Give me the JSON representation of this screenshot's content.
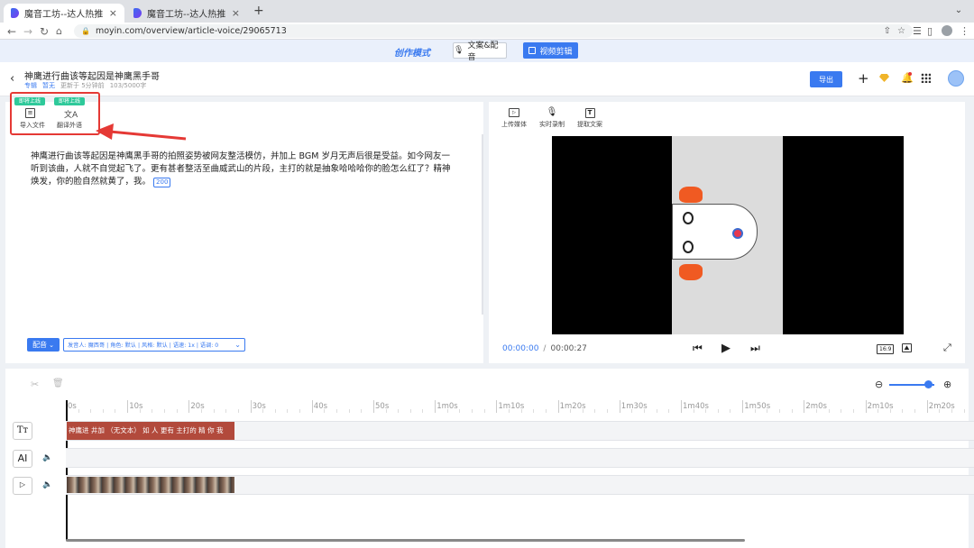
{
  "browser": {
    "tabs": [
      {
        "title": "魔音工坊--达人热推的短视频/有",
        "close": "×"
      },
      {
        "title": "魔音工坊--达人热推的短视频/有",
        "close": "×"
      }
    ],
    "new_tab": "+",
    "url": "moyin.com/overview/article-voice/29065713"
  },
  "mode_bar": {
    "logo": "创作模式",
    "text_dub_label": "文案&配音",
    "video_edit_label": "视频剪辑"
  },
  "header": {
    "title": "神鹰进行曲该等起因是神鹰黑手哥",
    "meta_items": [
      "专辑",
      "暂无",
      "更新于 5分钟前",
      "103/5000字"
    ],
    "export_label": "导出"
  },
  "editor": {
    "tools": [
      {
        "badge": "即将上线",
        "label": "导入文件",
        "icon": "file-icon"
      },
      {
        "badge": "即将上线",
        "label": "翻译外语",
        "icon": "translate-icon"
      }
    ],
    "content": "神鹰进行曲该等起因是神鹰黑手哥的拍照姿势被网友整活模仿，并加上 BGM 岁月无声后很是受益。如今网友一听到该曲，人就不自觉起飞了。更有甚者整活至曲威武山的片段，主打的就是抽象哈哈哈你的脸怎么红了？精神焕发，你的脸自然就黄了，我。",
    "badge_count": "200",
    "dub_button": "配音",
    "voice_settings": "发音人: 魔西哥 | 角色: 默认 | 风格: 默认 | 语速: 1x | 语调: 0"
  },
  "player": {
    "tools": [
      {
        "label": "上传媒体",
        "icon": "upload-media-icon"
      },
      {
        "label": "实时录制",
        "icon": "microphone-icon"
      },
      {
        "label": "提取文案",
        "icon": "text-extract-icon"
      }
    ],
    "current_time": "00:00:00",
    "separator": "/",
    "total_time": "00:00:27",
    "aspect_ratio": "16:9"
  },
  "timeline": {
    "ticks": [
      "0s",
      "10s",
      "20s",
      "30s",
      "40s",
      "50s",
      "1m0s",
      "1m10s",
      "1m20s",
      "1m30s",
      "1m40s",
      "1m50s",
      "2m0s",
      "2m10s",
      "2m20s"
    ],
    "text_track_label": "Tт",
    "ai_track_label": "AI",
    "subtitle_text": "神鹰进 井加 （无文本） 如 人 更有 主打的 精 你 我",
    "zoom_level": 0.85
  },
  "colors": {
    "accent": "#3a7af0",
    "badge_green": "#2ec99a",
    "clip_red": "#b24a3c",
    "highlight_red": "#e53935"
  }
}
